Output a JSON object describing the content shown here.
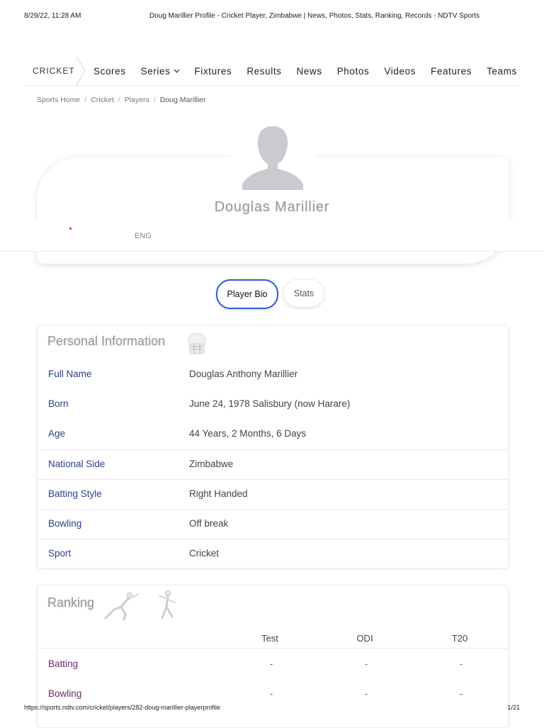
{
  "print_header": {
    "datetime": "8/29/22, 11:28 AM",
    "title": "Doug Marillier Profile - Cricket Player, Zimbabwe | News, Photos, Stats, Ranking, Records - NDTV Sports"
  },
  "print_footer": {
    "url": "https://sports.ndtv.com/cricket/players/282-doug-marillier-playerprofile",
    "page": "1/21"
  },
  "nav": {
    "brand": "CRICKET",
    "items": [
      "Scores",
      "Series",
      "Fixtures",
      "Results",
      "News",
      "Photos",
      "Videos",
      "Features",
      "Teams"
    ]
  },
  "breadcrumb": {
    "items": [
      "Sports Home",
      "Cricket",
      "Players"
    ],
    "current": "Doug Marillier"
  },
  "profile": {
    "name": "Douglas Marillier",
    "team_code": "ENG",
    "flag_color": "#e0202b"
  },
  "tabs": {
    "active": "Player Bio",
    "inactive": "Stats"
  },
  "personal": {
    "title": "Personal Information",
    "rows": [
      {
        "label": "Full Name",
        "value": "Douglas Anthony Marillier"
      },
      {
        "label": "Born",
        "value": "June 24, 1978 Salisbury (now Harare)"
      },
      {
        "label": "Age",
        "value": "44 Years, 2 Months, 6 Days"
      },
      {
        "label": "National Side",
        "value": "Zimbabwe"
      },
      {
        "label": "Batting Style",
        "value": "Right Handed"
      },
      {
        "label": "Bowling",
        "value": "Off break"
      },
      {
        "label": "Sport",
        "value": "Cricket"
      }
    ]
  },
  "ranking": {
    "title": "Ranking",
    "columns": [
      "Test",
      "ODI",
      "T20"
    ],
    "rows": [
      {
        "label": "Batting",
        "values": [
          "-",
          "-",
          "-"
        ]
      },
      {
        "label": "Bowling",
        "values": [
          "-",
          "-",
          "-"
        ]
      }
    ]
  },
  "colors": {
    "accent": "#2c5fd6",
    "label_blue": "#2c3e8a",
    "label_purple": "#6b2a6b"
  }
}
